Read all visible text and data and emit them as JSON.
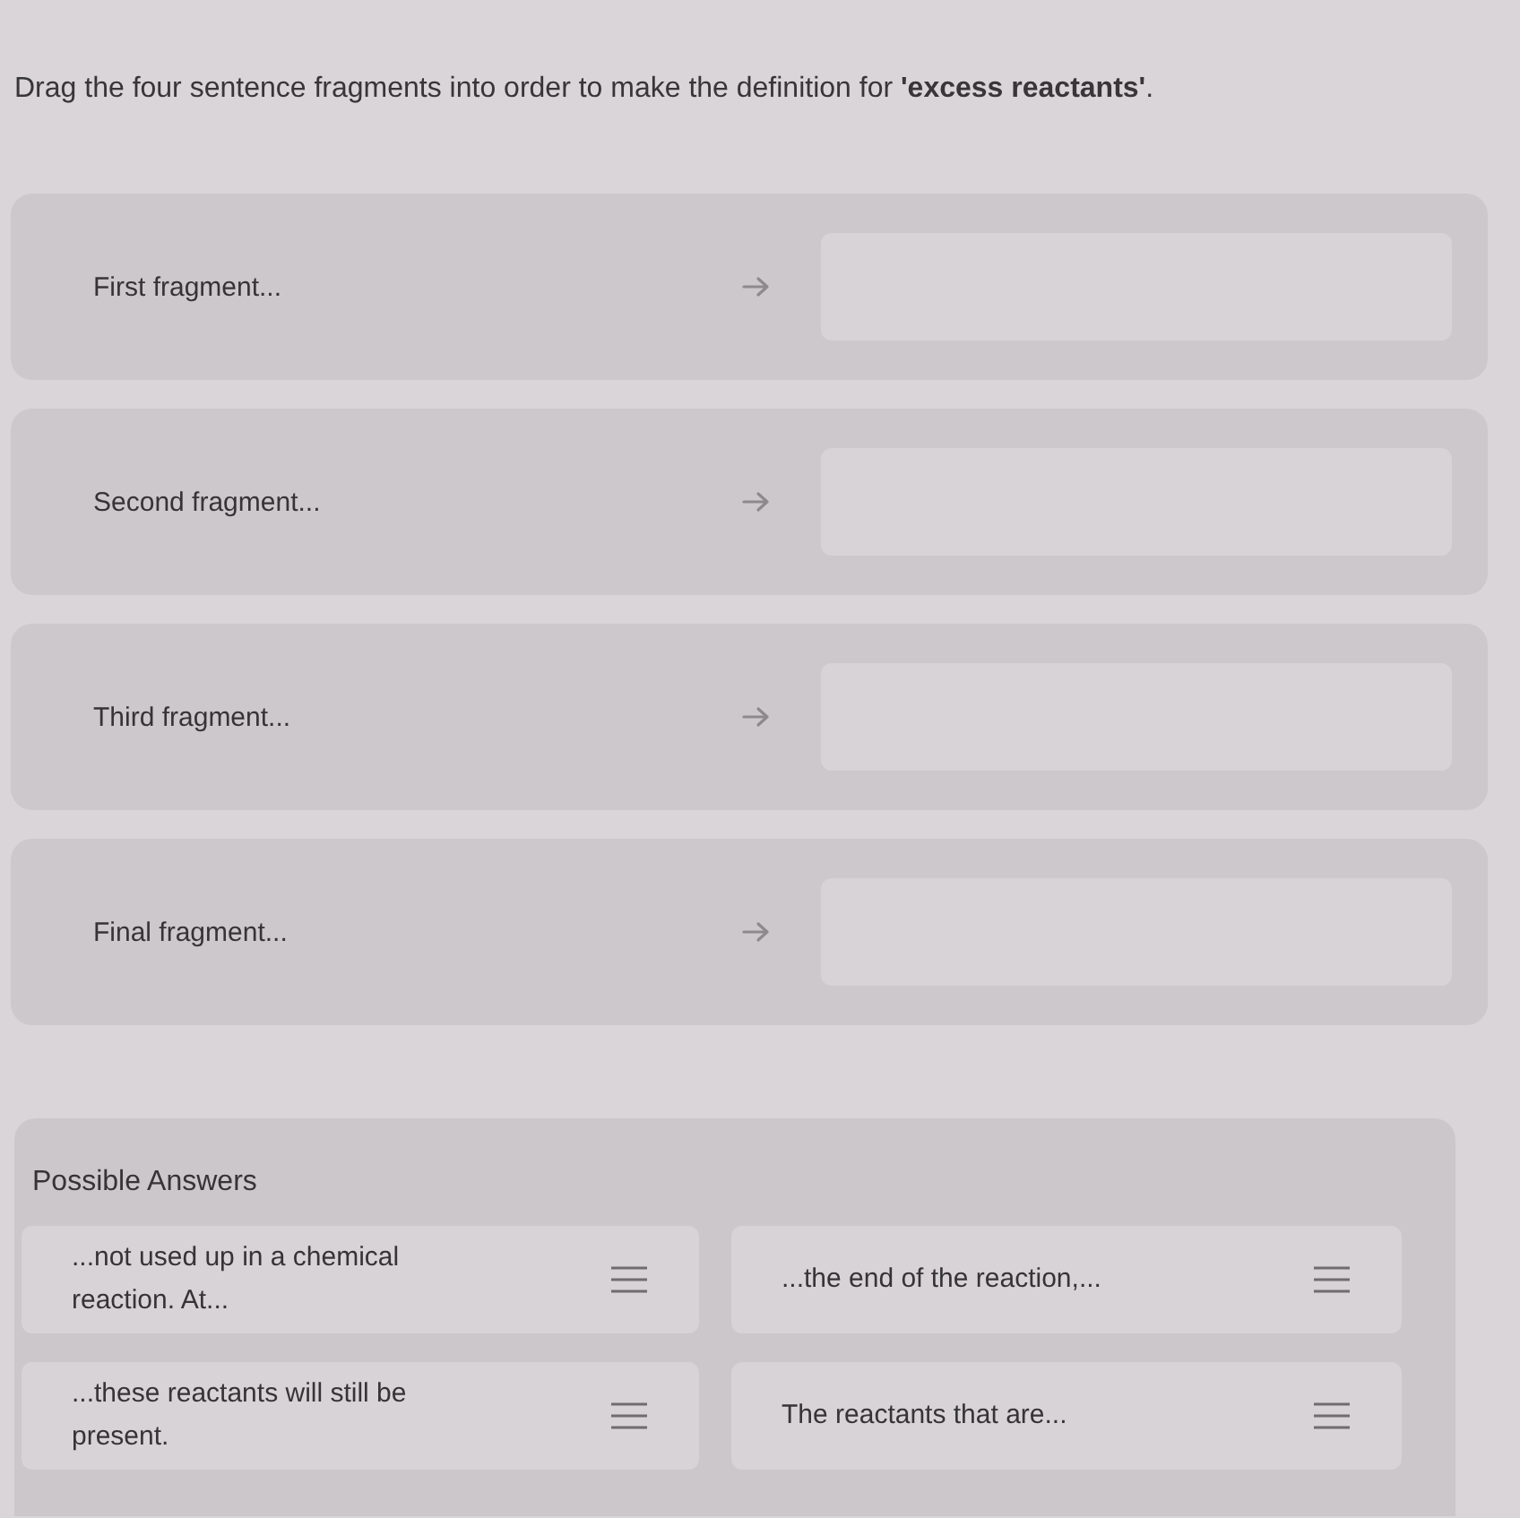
{
  "instruction": "Drag the four sentence fragments into order to make the definition for **'excess reactants'**.",
  "slots": [
    {
      "label": "First fragment..."
    },
    {
      "label": "Second fragment..."
    },
    {
      "label": "Third fragment..."
    },
    {
      "label": "Final fragment..."
    }
  ],
  "possible_answers": {
    "title": "Possible Answers",
    "items": [
      {
        "text": "...not used up in a chemical reaction. At..."
      },
      {
        "text": "...the end of the reaction,..."
      },
      {
        "text": "...these reactants will still be present."
      },
      {
        "text": "The reactants that are..."
      }
    ]
  }
}
